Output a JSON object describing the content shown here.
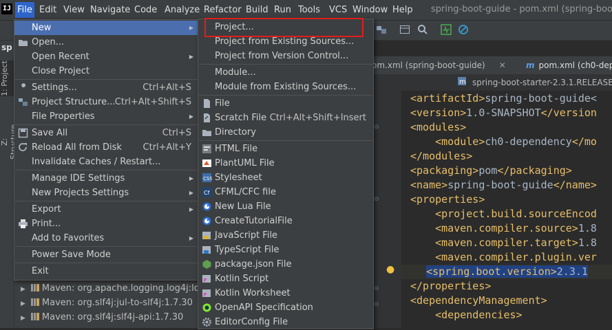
{
  "app_logo": "IJ",
  "menubar": {
    "items": [
      "File",
      "Edit",
      "View",
      "Navigate",
      "Code",
      "Analyze",
      "Refactor",
      "Build",
      "Run",
      "Tools",
      "VCS",
      "Window",
      "Help"
    ],
    "window_title": "spring-boot-guide - pom.xml (spring-boot-g"
  },
  "left_stripe": {
    "project_label": "sp",
    "tab_project": "1: Project",
    "tab_structure": "Z: Structure"
  },
  "tabs": [
    {
      "label": "om.xml (spring-boot-guide)",
      "close": "✕"
    },
    {
      "icon": "m",
      "label": "pom.xml (ch0-dep"
    }
  ],
  "breadcrumb": "spring-boot-starter-2.3.1.RELEASE.p",
  "code_lines": [
    {
      "indent": "",
      "tag_open": "<artifactId>",
      "text": "spring-boot-guide<",
      "tag_close": ""
    },
    {
      "indent": "",
      "tag_open": "<version>",
      "text": "1.0-SNAPSHOT",
      "tag_close": "</version"
    },
    {
      "indent": "",
      "tag_open": "<modules>",
      "text": "",
      "tag_close": ""
    },
    {
      "indent": "    ",
      "tag_open": "<module>",
      "text": "ch0-dependency",
      "tag_close": "</mo"
    },
    {
      "indent": "",
      "tag_open": "</modules>",
      "text": "",
      "tag_close": ""
    },
    {
      "indent": "",
      "tag_open": "<packaging>",
      "text": "pom",
      "tag_close": "</packaging>"
    },
    {
      "indent": "",
      "tag_open": "<name>",
      "text": "spring-boot-guide",
      "tag_close": "</name>"
    },
    {
      "indent": "",
      "tag_open": "<properties>",
      "text": "",
      "tag_close": ""
    },
    {
      "indent": "    ",
      "tag_open": "<project.build.sourceEncod",
      "text": "",
      "tag_close": ""
    },
    {
      "indent": "    ",
      "tag_open": "<maven.compiler.source>",
      "text": "1.8",
      "tag_close": ""
    },
    {
      "indent": "    ",
      "tag_open": "<maven.compiler.target>",
      "text": "1.8",
      "tag_close": ""
    },
    {
      "indent": "    ",
      "tag_open": "<maven.compiler.plugin.ver",
      "text": "",
      "tag_close": ""
    },
    {
      "indent": "    ",
      "tag_open": "<spring.boot.version>",
      "text": "2.3.1",
      "tag_close": ""
    },
    {
      "indent": "",
      "tag_open": "</properties>",
      "text": "",
      "tag_close": ""
    },
    {
      "indent": "",
      "tag_open": "<dependencyManagement>",
      "text": "",
      "tag_close": ""
    },
    {
      "indent": "    ",
      "tag_open": "<dependencies>",
      "text": "",
      "tag_close": ""
    }
  ],
  "tree_rows": [
    "Maven: org.apache.logging.log4j:log4",
    "Maven: org.slf4j:jul-to-slf4j:1.7.30",
    "Maven: org.slf4j:slf4j-api:1.7.30"
  ],
  "file_menu": [
    {
      "label": "New",
      "submenu": true,
      "highlight": true
    },
    {
      "label": "Open...",
      "icon": "folder"
    },
    {
      "label": "Open Recent",
      "submenu": true
    },
    {
      "label": "Close Project"
    },
    {
      "sep": true
    },
    {
      "label": "Settings...",
      "shortcut": "Ctrl+Alt+S",
      "icon": "wrench"
    },
    {
      "label": "Project Structure...",
      "shortcut": "Ctrl+Alt+Shift+S",
      "icon": "structure"
    },
    {
      "label": "File Properties",
      "submenu": true
    },
    {
      "sep": true
    },
    {
      "label": "Save All",
      "shortcut": "Ctrl+S",
      "icon": "save"
    },
    {
      "label": "Reload All from Disk",
      "shortcut": "Ctrl+Alt+Y",
      "icon": "reload"
    },
    {
      "label": "Invalidate Caches / Restart..."
    },
    {
      "sep": true
    },
    {
      "label": "Manage IDE Settings",
      "submenu": true
    },
    {
      "label": "New Projects Settings",
      "submenu": true
    },
    {
      "sep": true
    },
    {
      "label": "Export",
      "submenu": true
    },
    {
      "label": "Print...",
      "icon": "print"
    },
    {
      "label": "Add to Favorites",
      "submenu": true
    },
    {
      "sep": true
    },
    {
      "label": "Power Save Mode"
    },
    {
      "sep": true
    },
    {
      "label": "Exit"
    }
  ],
  "new_menu": [
    {
      "label": "Project..."
    },
    {
      "label": "Project from Existing Sources..."
    },
    {
      "label": "Project from Version Control..."
    },
    {
      "sep": true
    },
    {
      "label": "Module..."
    },
    {
      "label": "Module from Existing Sources..."
    },
    {
      "sep": true
    },
    {
      "label": "File",
      "icon": "file"
    },
    {
      "label": "Scratch File",
      "shortcut": "Ctrl+Alt+Shift+Insert",
      "icon": "scratch"
    },
    {
      "label": "Directory",
      "icon": "folder"
    },
    {
      "sep": true
    },
    {
      "label": "HTML File",
      "icon": "html"
    },
    {
      "label": "PlantUML File",
      "icon": "plantuml"
    },
    {
      "label": "Stylesheet",
      "icon": "css"
    },
    {
      "label": "CFML/CFC file",
      "icon": "cf"
    },
    {
      "label": "New Lua File",
      "icon": "lua"
    },
    {
      "label": "CreateTutorialFile",
      "icon": "lua"
    },
    {
      "label": "JavaScript File",
      "icon": "js"
    },
    {
      "label": "TypeScript File",
      "icon": "ts"
    },
    {
      "label": "package.json File",
      "icon": "node"
    },
    {
      "label": "Kotlin Script",
      "icon": "kotlin"
    },
    {
      "label": "Kotlin Worksheet",
      "icon": "kotlin"
    },
    {
      "label": "OpenAPI Specification",
      "icon": "openapi"
    },
    {
      "label": "EditorConfig File",
      "icon": "gear"
    }
  ]
}
